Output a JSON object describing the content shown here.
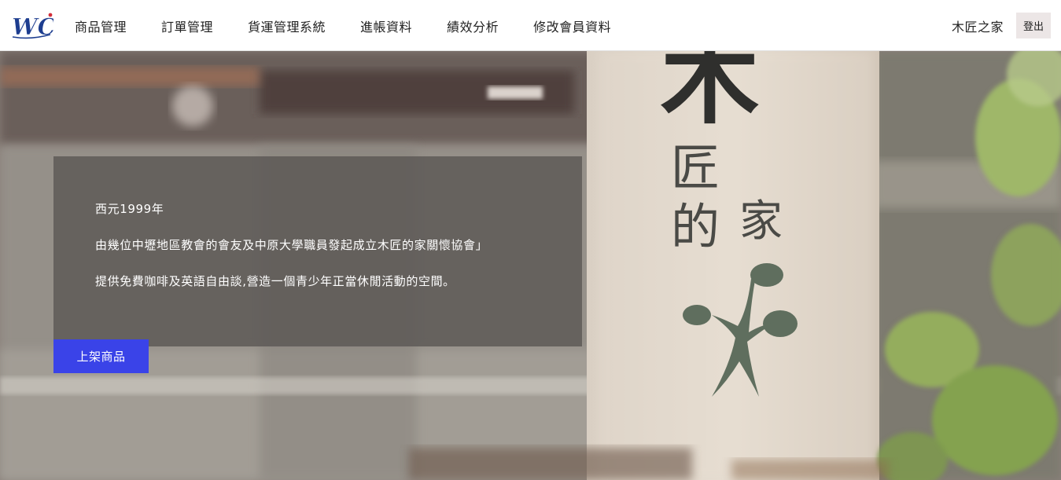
{
  "brand": {
    "logo_text": "WC",
    "accent": "#3a43e8"
  },
  "nav": {
    "items": [
      {
        "label": "商品管理"
      },
      {
        "label": "訂單管理"
      },
      {
        "label": "貨運管理系統"
      },
      {
        "label": "進帳資料"
      },
      {
        "label": "績效分析"
      },
      {
        "label": "修改會員資料"
      }
    ],
    "user_name": "木匠之家",
    "logout_label": "登出"
  },
  "hero": {
    "sign_chars": [
      "木",
      "匠",
      "的",
      "家"
    ],
    "lines": [
      "西元1999年",
      "由幾位中壢地區教會的會友及中原大學職員發起成立木匠的家關懷協會」",
      "提供免費咖啡及英語自由談,營造一個青少年正當休閒活動的空間。"
    ],
    "cta_label": "上架商品"
  }
}
